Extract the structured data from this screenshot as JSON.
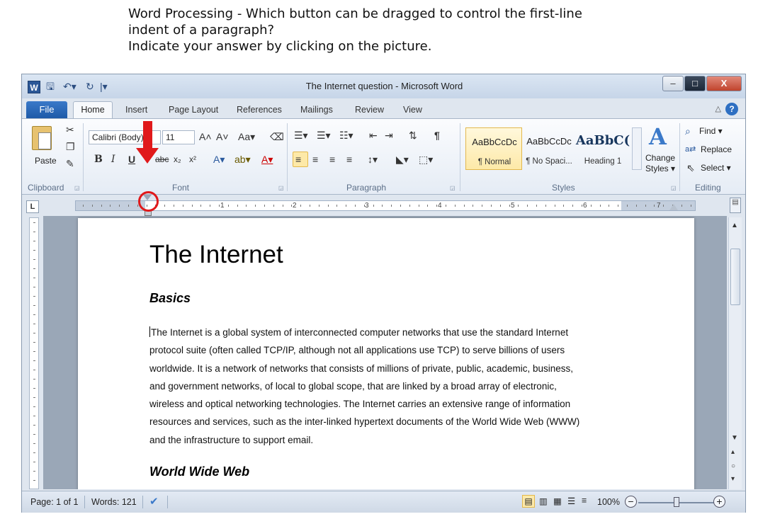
{
  "question": {
    "line1": "Word Processing - Which button can be dragged to control the first-line",
    "line2": "indent of a paragraph?",
    "line3": "Indicate your answer by clicking on the picture."
  },
  "window": {
    "title": "The Internet question  -  Microsoft Word",
    "app_icon": "W",
    "qat": [
      "save-icon",
      "undo-icon",
      "redo-icon",
      "customize-icon"
    ]
  },
  "tabs": [
    "File",
    "Home",
    "Insert",
    "Page Layout",
    "References",
    "Mailings",
    "Review",
    "View"
  ],
  "ribbon": {
    "clipboard": {
      "label": "Clipboard",
      "paste": "Paste"
    },
    "font": {
      "label": "Font",
      "font_name": "Calibri (Body)",
      "font_size": "11",
      "bold": "B",
      "italic": "I",
      "underline": "U"
    },
    "paragraph": {
      "label": "Paragraph",
      "pilcrow": "¶"
    },
    "styles": {
      "label": "Styles",
      "items": [
        {
          "sample": "AaBbCcDc",
          "name": "¶ Normal"
        },
        {
          "sample": "AaBbCcDc",
          "name": "¶ No Spaci..."
        },
        {
          "sample": "AaBbC(",
          "name": "Heading 1"
        }
      ],
      "change_styles": [
        "Change",
        "Styles ▾"
      ]
    },
    "editing": {
      "label": "Editing",
      "find": "Find ▾",
      "replace": "Replace",
      "select": "Select ▾"
    }
  },
  "ruler": {
    "tab_selector": "L",
    "numbers": [
      "1",
      "2",
      "3",
      "4",
      "5",
      "6",
      "7"
    ]
  },
  "document": {
    "title": "The Internet",
    "heading1": "Basics",
    "body_lines": [
      "The Internet is a global system of interconnected computer networks that use the standard Internet",
      "protocol suite (often called TCP/IP, although not all applications use TCP) to serve billions of users",
      "worldwide. It is a network of networks that consists of millions of private, public, academic, business,",
      "and government networks, of local to global scope, that are linked by a broad array of electronic,",
      "wireless and optical networking technologies. The Internet carries an extensive range of information",
      "resources and services, such as the inter-linked hypertext documents of the World Wide Web (WWW)",
      "and the infrastructure to support email."
    ],
    "heading2": "World Wide Web"
  },
  "status": {
    "page": "Page: 1 of 1",
    "words": "Words: 121",
    "zoom": "100%",
    "zoom_fraction": 0.5
  },
  "colors": {
    "accent_red": "#e0191b",
    "file_tab": "#2b6fc2"
  }
}
